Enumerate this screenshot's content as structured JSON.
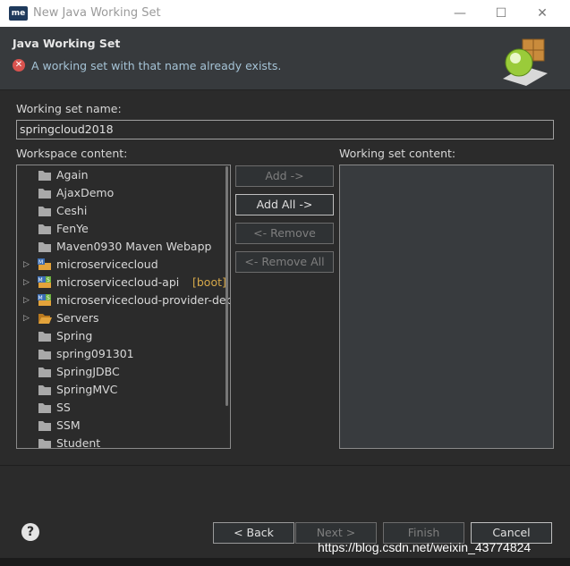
{
  "window": {
    "title": "New Java Working Set",
    "app_icon": "me",
    "minimize_glyph": "—",
    "maximize_glyph": "☐",
    "close_glyph": "✕"
  },
  "header": {
    "title": "Java Working Set",
    "error_message": "A working set with that name already exists.",
    "error_icon_glyph": "✕"
  },
  "form": {
    "name_label": "Working set name:",
    "name_value": "springcloud2018",
    "workspace_label": "Workspace content:",
    "set_content_label": "Working set content:"
  },
  "tree": [
    {
      "label": "Again",
      "icon": "folder-icon",
      "expandable": false
    },
    {
      "label": "AjaxDemo",
      "icon": "folder-icon",
      "expandable": false
    },
    {
      "label": "Ceshi",
      "icon": "folder-icon",
      "expandable": false
    },
    {
      "label": "FenYe",
      "icon": "folder-icon",
      "expandable": false
    },
    {
      "label": "Maven0930 Maven Webapp",
      "icon": "folder-icon",
      "expandable": false
    },
    {
      "label": "microservicecloud",
      "icon": "maven-project-icon",
      "expandable": true
    },
    {
      "label": "microservicecloud-api",
      "suffix": "[boot]",
      "icon": "spring-boot-project-icon",
      "expandable": true
    },
    {
      "label": "microservicecloud-provider-dep",
      "icon": "spring-boot-project-icon",
      "expandable": true
    },
    {
      "label": "Servers",
      "icon": "open-folder-icon",
      "expandable": true
    },
    {
      "label": "Spring",
      "icon": "folder-icon",
      "expandable": false
    },
    {
      "label": "spring091301",
      "icon": "folder-icon",
      "expandable": false
    },
    {
      "label": "SpringJDBC",
      "icon": "folder-icon",
      "expandable": false
    },
    {
      "label": "SpringMVC",
      "icon": "folder-icon",
      "expandable": false
    },
    {
      "label": "SS",
      "icon": "folder-icon",
      "expandable": false
    },
    {
      "label": "SSM",
      "icon": "folder-icon",
      "expandable": false
    },
    {
      "label": "Student",
      "icon": "folder-icon",
      "expandable": false
    }
  ],
  "buttons": {
    "add": "Add ->",
    "add_all": "Add All ->",
    "remove": "<- Remove",
    "remove_all": "<- Remove All",
    "back": "< Back",
    "next": "Next >",
    "finish": "Finish",
    "cancel": "Cancel",
    "help": "?"
  },
  "watermark": "https://blog.csdn.net/weixin_43774824",
  "colors": {
    "error": "#d9534f",
    "error_text": "#a5c3d6",
    "boot_suffix": "#d6a84a",
    "folder": "#a9a9a9",
    "open_folder": "#e3a33b"
  }
}
